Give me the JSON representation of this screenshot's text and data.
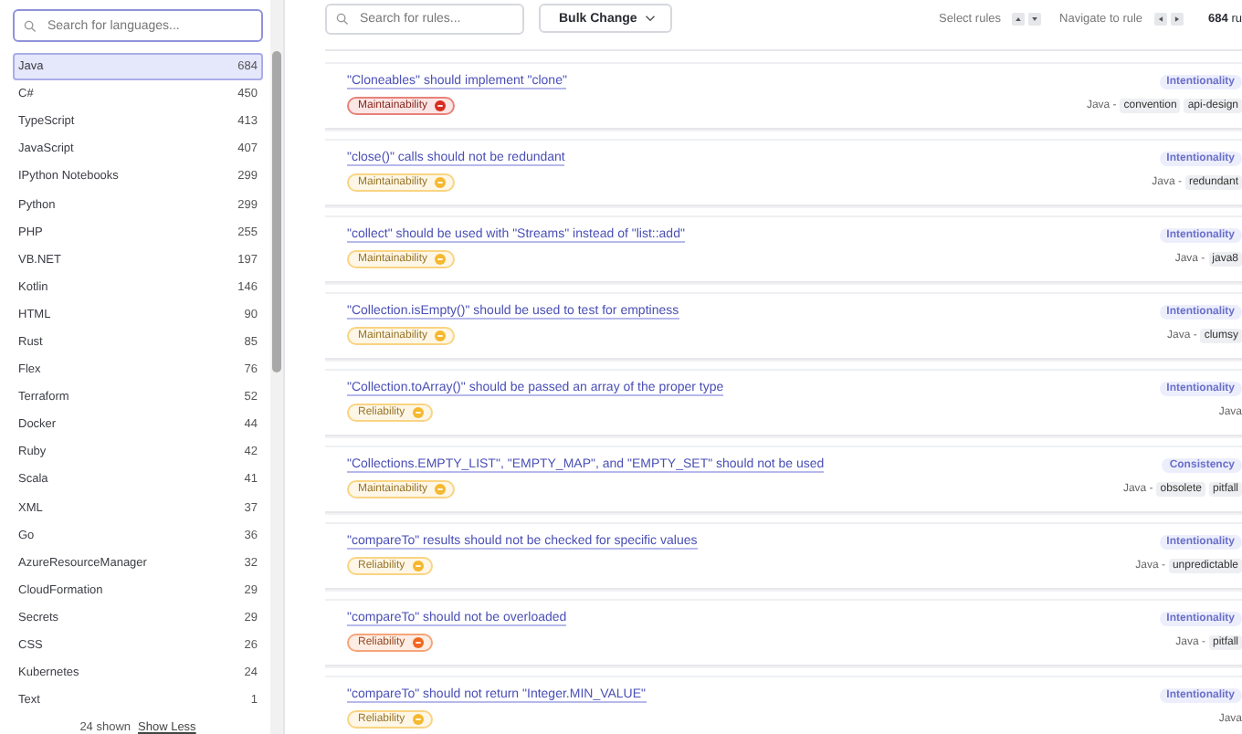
{
  "sidebar": {
    "search": {
      "placeholder": "Search for languages..."
    },
    "languages": [
      {
        "name": "Java",
        "count": "684",
        "selected": true
      },
      {
        "name": "C#",
        "count": "450",
        "selected": false
      },
      {
        "name": "TypeScript",
        "count": "413",
        "selected": false
      },
      {
        "name": "JavaScript",
        "count": "407",
        "selected": false
      },
      {
        "name": "IPython Notebooks",
        "count": "299",
        "selected": false
      },
      {
        "name": "Python",
        "count": "299",
        "selected": false
      },
      {
        "name": "PHP",
        "count": "255",
        "selected": false
      },
      {
        "name": "VB.NET",
        "count": "197",
        "selected": false
      },
      {
        "name": "Kotlin",
        "count": "146",
        "selected": false
      },
      {
        "name": "HTML",
        "count": "90",
        "selected": false
      },
      {
        "name": "Rust",
        "count": "85",
        "selected": false
      },
      {
        "name": "Flex",
        "count": "76",
        "selected": false
      },
      {
        "name": "Terraform",
        "count": "52",
        "selected": false
      },
      {
        "name": "Docker",
        "count": "44",
        "selected": false
      },
      {
        "name": "Ruby",
        "count": "42",
        "selected": false
      },
      {
        "name": "Scala",
        "count": "41",
        "selected": false
      },
      {
        "name": "XML",
        "count": "37",
        "selected": false
      },
      {
        "name": "Go",
        "count": "36",
        "selected": false
      },
      {
        "name": "AzureResourceManager",
        "count": "32",
        "selected": false
      },
      {
        "name": "CloudFormation",
        "count": "29",
        "selected": false
      },
      {
        "name": "Secrets",
        "count": "29",
        "selected": false
      },
      {
        "name": "CSS",
        "count": "26",
        "selected": false
      },
      {
        "name": "Kubernetes",
        "count": "24",
        "selected": false
      },
      {
        "name": "Text",
        "count": "1",
        "selected": false
      }
    ],
    "footer": {
      "shown": "24 shown",
      "link": "Show Less"
    }
  },
  "toolbar": {
    "search": {
      "placeholder": "Search for rules..."
    },
    "bulk_change": "Bulk Change",
    "select_rules": "Select rules",
    "navigate": "Navigate to rule",
    "total": "**684** ru"
  },
  "rules": [
    {
      "title": "\"Cloneables\" should implement \"clone\"",
      "attribute": "Intentionality",
      "quality": "Maintainability",
      "color": "#d92d20",
      "language": "Java -",
      "tags": [
        "convention",
        "api-design"
      ]
    },
    {
      "title": "\"close()\" calls should not be redundant",
      "attribute": "Intentionality",
      "quality": "Maintainability",
      "color": "#f5b82e",
      "language": "Java -",
      "tags": [
        "redundant"
      ]
    },
    {
      "title": "\"collect\" should be used with \"Streams\" instead of \"list::add\"",
      "attribute": "Intentionality",
      "quality": "Maintainability",
      "color": "#f5b82e",
      "language": "Java -",
      "tags": [
        "java8"
      ]
    },
    {
      "title": "\"Collection.isEmpty()\" should be used to test for emptiness",
      "attribute": "Intentionality",
      "quality": "Maintainability",
      "color": "#f5b82e",
      "language": "Java -",
      "tags": [
        "clumsy"
      ]
    },
    {
      "title": "\"Collection.toArray()\" should be passed an array of the proper type",
      "attribute": "Intentionality",
      "quality": "Reliability",
      "color": "#f5b82e",
      "language": "Java"
    },
    {
      "title": "\"Collections.EMPTY_LIST\", \"EMPTY_MAP\", and \"EMPTY_SET\" should not be used",
      "attribute": "Consistency",
      "quality": "Maintainability",
      "color": "#f5b82e",
      "language": "Java -",
      "tags": [
        "obsolete",
        "pitfall"
      ]
    },
    {
      "title": "\"compareTo\" results should not be checked for specific values",
      "attribute": "Intentionality",
      "quality": "Reliability",
      "color": "#f5b82e",
      "language": "Java -",
      "tags": [
        "unpredictable"
      ]
    },
    {
      "title": "\"compareTo\" should not be overloaded",
      "attribute": "Intentionality",
      "quality": "Reliability",
      "color": "#f0671f",
      "language": "Java -",
      "tags": [
        "pitfall"
      ]
    },
    {
      "title": "\"compareTo\" should not return \"Integer.MIN_VALUE\"",
      "attribute": "Intentionality",
      "quality": "Reliability",
      "color": "#f5b82e",
      "language": "Java"
    }
  ]
}
